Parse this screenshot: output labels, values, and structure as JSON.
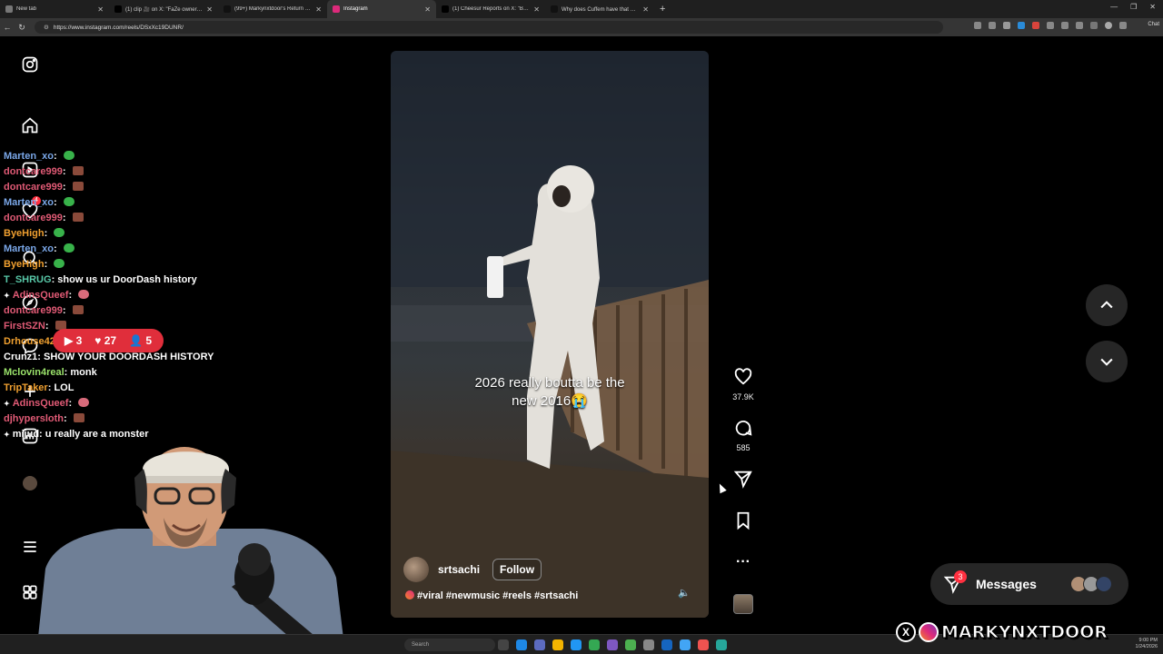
{
  "browser": {
    "tabs": [
      {
        "title": "New tab",
        "icon": "new-tab-icon",
        "color": "#777777"
      },
      {
        "title": "(1) clip 🎥 on X: \"FaZe owners are",
        "icon": "x-icon",
        "color": "#000000"
      },
      {
        "title": "(99+) Markynxtdoor's Return to L",
        "icon": "tiktok-icon",
        "color": "#111111"
      },
      {
        "title": "Instagram",
        "icon": "instagram-icon",
        "color": "#dd2a7b"
      },
      {
        "title": "(1) Cheesur Reports on X: \"BREAK",
        "icon": "x-icon",
        "color": "#000000"
      },
      {
        "title": "Why does Cuffem have that 😭 #",
        "icon": "tiktok-icon",
        "color": "#111111"
      }
    ],
    "url": "https://www.instagram.com/reels/DSxXc19DUNR/",
    "chat_label": "Chat"
  },
  "chat": [
    {
      "user": "Marten_xo",
      "color": "#7aa7e8",
      "msg": "",
      "emote": "green"
    },
    {
      "user": "dontcare999",
      "color": "#e05a75",
      "msg": "",
      "emote": "brown"
    },
    {
      "user": "dontcare999",
      "color": "#e05a75",
      "msg": "",
      "emote": "brown"
    },
    {
      "user": "Marten_xo",
      "color": "#7aa7e8",
      "msg": "",
      "emote": "green"
    },
    {
      "user": "dontcare999",
      "color": "#e05a75",
      "msg": "",
      "emote": "brown"
    },
    {
      "user": "ByeHigh",
      "color": "#f0a030",
      "msg": "",
      "emote": "green"
    },
    {
      "user": "Marten_xo",
      "color": "#7aa7e8",
      "msg": "",
      "emote": "green"
    },
    {
      "user": "ByeHigh",
      "color": "#f0a030",
      "msg": "",
      "emote": "green"
    },
    {
      "user": "T_SHRUG",
      "color": "#58c8a8",
      "msg": "show us ur DoorDash history",
      "emote": ""
    },
    {
      "user": "AdinsQueef",
      "color": "#e05a75",
      "msg": "",
      "emote": "pink",
      "badge": true
    },
    {
      "user": "dontcare999",
      "color": "#e05a75",
      "msg": "",
      "emote": "brown"
    },
    {
      "user": "FirstSZN",
      "color": "#e05a75",
      "msg": "",
      "emote": "brown"
    },
    {
      "user": "Drhouse420",
      "color": "#f0a030",
      "msg": "",
      "emote": ""
    },
    {
      "user": "Crunz1",
      "color": "#ffffff",
      "msg": "SHOW YOUR DOORDASH HISTORY",
      "emote": ""
    },
    {
      "user": "Mclovin4real",
      "color": "#9be36b",
      "msg": "monk",
      "emote": ""
    },
    {
      "user": "TripTaker",
      "color": "#f0a030",
      "msg": "LOL",
      "emote": ""
    },
    {
      "user": "AdinsQueef",
      "color": "#e05a75",
      "msg": "",
      "emote": "pink",
      "badge": true
    },
    {
      "user": "djhypersloth",
      "color": "#e05a75",
      "msg": "",
      "emote": "brown"
    },
    {
      "user": "mijud",
      "color": "#ffffff",
      "msg": "u really are a monster",
      "emote": "",
      "badge": true
    }
  ],
  "live_stats": {
    "clips": "3",
    "likes": "27",
    "viewers": "5"
  },
  "nav": {
    "notifications_count": "4"
  },
  "reel": {
    "caption_line1": "2026 really boutta be the",
    "caption_line2": "new 2016😭",
    "username": "srtsachi",
    "follow_label": "Follow",
    "tags": "#viral #newmusic #reels #srtsachi",
    "likes": "37.9K",
    "comments": "585"
  },
  "messages": {
    "label": "Messages",
    "badge": "3"
  },
  "taskbar": {
    "search_placeholder": "Search",
    "time": "9:00 PM",
    "date": "1/24/2026"
  },
  "brand": {
    "name": "MARKYNXTDOOR"
  },
  "colors": {
    "accent_red": "#ff3040",
    "live_red": "#e02e3b",
    "panel": "#262626"
  }
}
